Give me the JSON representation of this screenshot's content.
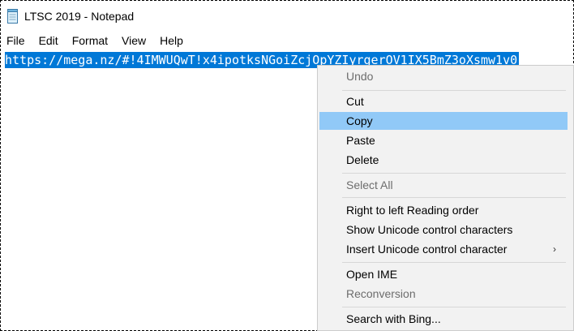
{
  "window": {
    "title": "LTSC 2019 - Notepad"
  },
  "menubar": {
    "items": [
      "File",
      "Edit",
      "Format",
      "View",
      "Help"
    ]
  },
  "editor": {
    "selected_text": "https://mega.nz/#!4IMWUQwT!x4ipotksNGoiZcjOpYZIyrgerOV1IX5BmZ3oXsmw1v0"
  },
  "context_menu": {
    "undo": "Undo",
    "cut": "Cut",
    "copy": "Copy",
    "paste": "Paste",
    "delete": "Delete",
    "select_all": "Select All",
    "rtl": "Right to left Reading order",
    "show_unicode": "Show Unicode control characters",
    "insert_unicode": "Insert Unicode control character",
    "open_ime": "Open IME",
    "reconversion": "Reconversion",
    "search_bing": "Search with Bing...",
    "submenu_arrow": "›"
  },
  "colors": {
    "selection": "#0078d7",
    "menu_highlight": "#91c9f7",
    "menu_background": "#f2f2f2",
    "disabled_text": "#6d6d6d"
  },
  "icons": {
    "app": "notepad-icon",
    "submenu": "chevron-right-icon"
  }
}
